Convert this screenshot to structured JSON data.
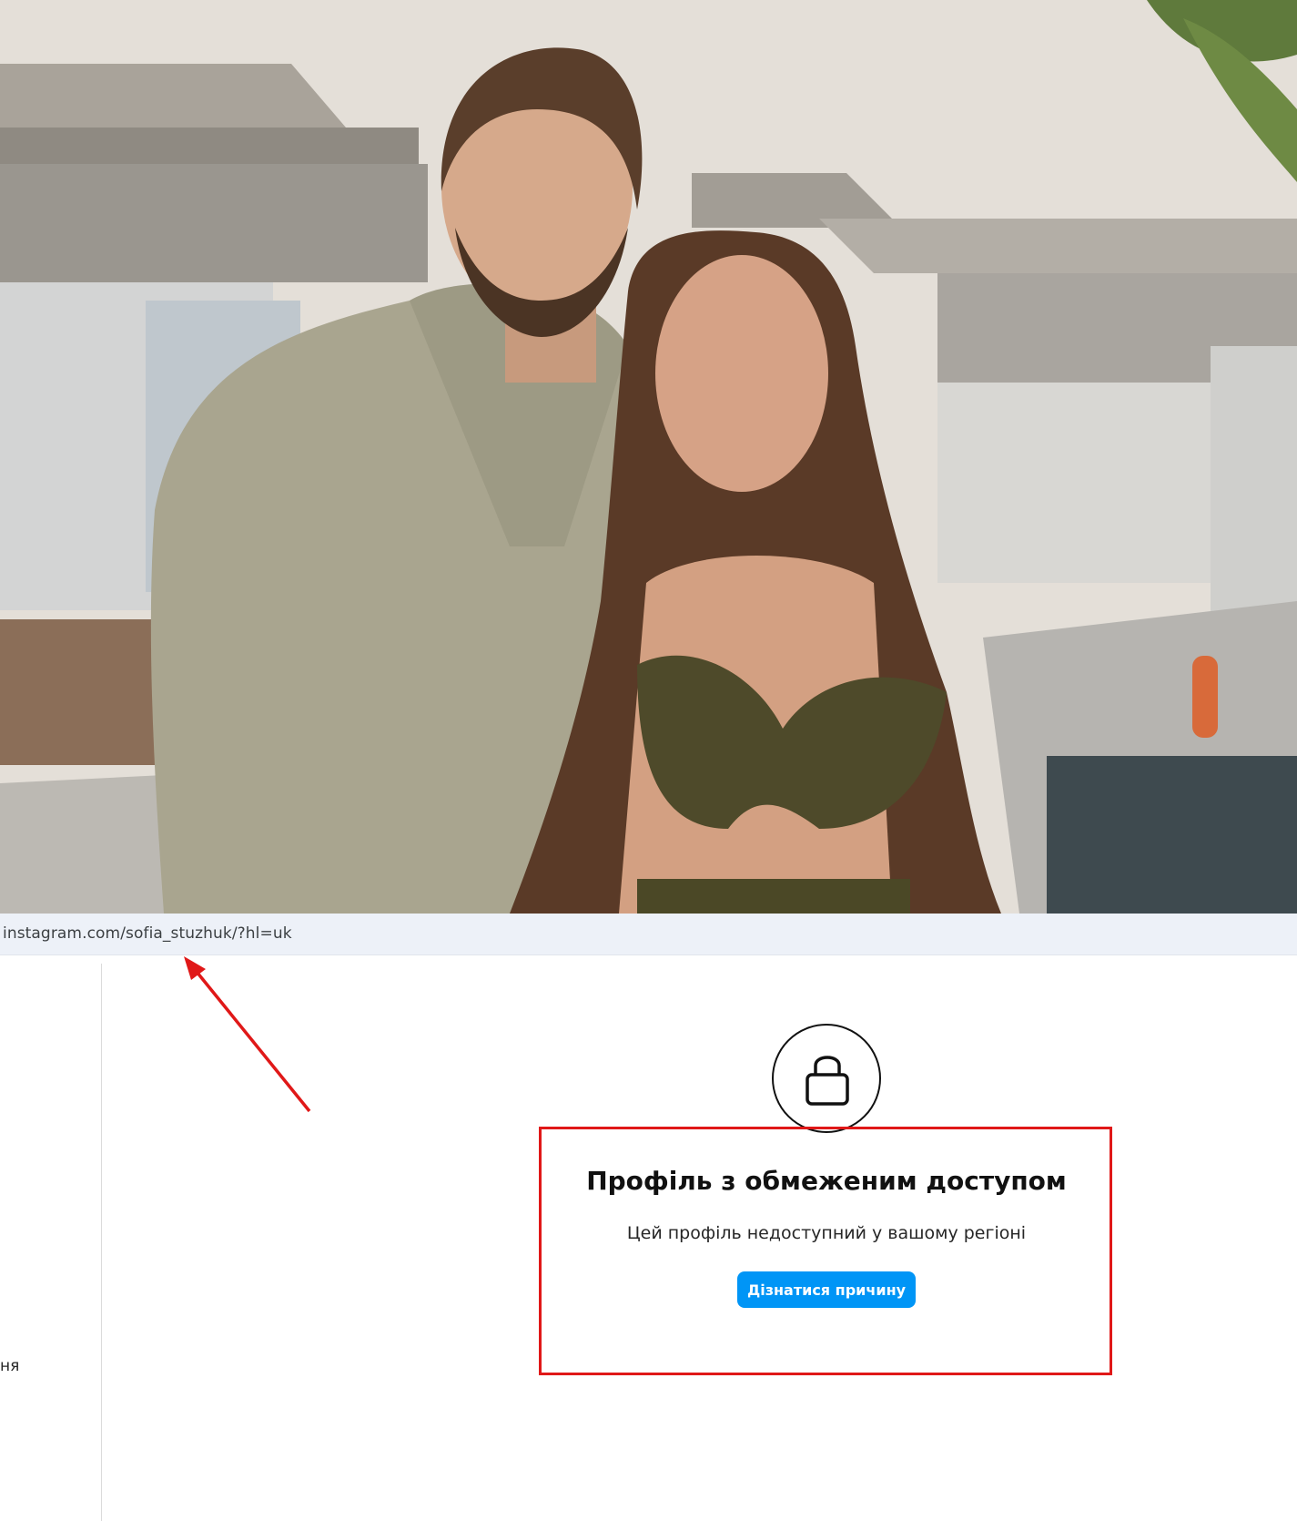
{
  "address_bar": {
    "url": "instagram.com/sofia_stuzhuk/?hl=uk"
  },
  "sidebar": {
    "partial_item_label": "ня"
  },
  "profile_restricted": {
    "lock_icon": "lock-icon",
    "title": "Профіль з обмеженим доступом",
    "subtitle": "Цей профіль недоступний у вашому регіоні",
    "button_label": "Дізнатися причину"
  },
  "colors": {
    "button_blue": "#0095f6",
    "annotation_red": "#e01818",
    "address_bar_bg": "#edf1f8"
  }
}
